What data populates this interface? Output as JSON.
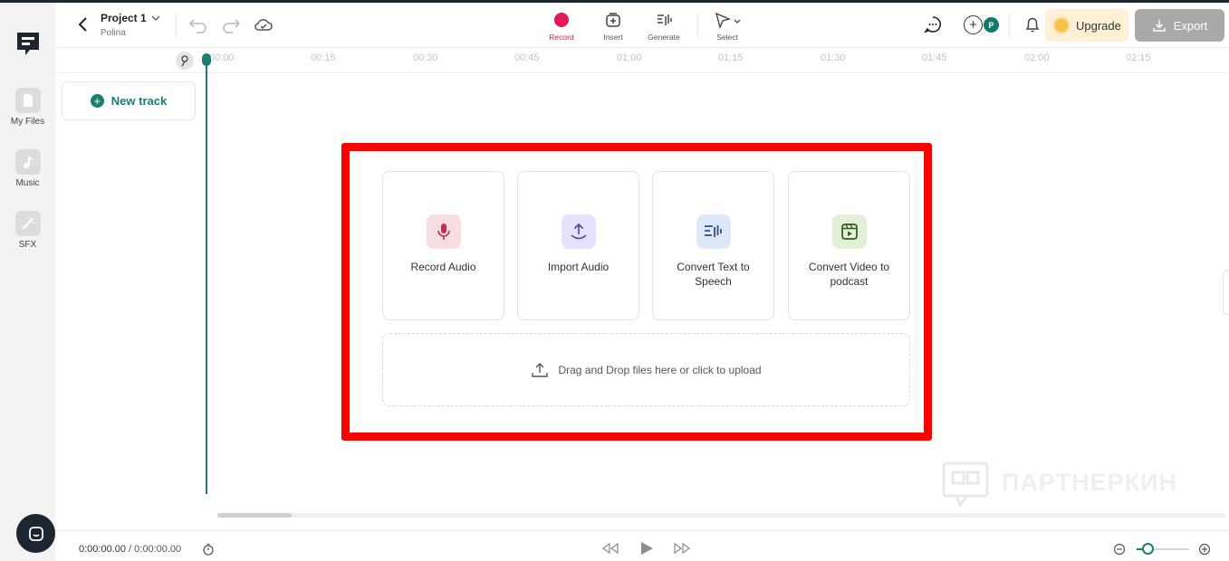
{
  "colors": {
    "accent": "#17806e",
    "record": "#e3195a",
    "highlight_frame": "#ff0000",
    "export_bg": "#a9a9a9",
    "upgrade_bg": "#fdf0d5"
  },
  "sidebar": {
    "items": [
      {
        "label": "My Files",
        "icon": "folder-icon"
      },
      {
        "label": "Music",
        "icon": "music-note-icon"
      },
      {
        "label": "SFX",
        "icon": "magic-wand-icon"
      }
    ]
  },
  "header": {
    "project_title": "Project 1",
    "project_owner": "Polina",
    "tools": [
      {
        "label": "Record",
        "icon": "record-icon"
      },
      {
        "label": "Insert",
        "icon": "insert-icon"
      },
      {
        "label": "Generate",
        "icon": "generate-icon"
      },
      {
        "label": "Select",
        "icon": "cursor-icon"
      }
    ],
    "avatar_initial": "P",
    "upgrade_label": "Upgrade",
    "export_label": "Export"
  },
  "ruler": {
    "ticks": [
      "00:00",
      "00:15",
      "00:30",
      "00:45",
      "01:00",
      "01:15",
      "01:30",
      "01:45",
      "02:00",
      "02:15"
    ]
  },
  "tracks": {
    "new_track_label": "New track"
  },
  "start_options": {
    "cards": [
      {
        "label": "Record Audio",
        "icon": "microphone-icon"
      },
      {
        "label": "Import Audio",
        "icon": "upload-icon"
      },
      {
        "label": "Convert Text to Speech",
        "icon": "text-to-speech-icon"
      },
      {
        "label": "Convert Video to podcast",
        "icon": "video-icon"
      }
    ],
    "dropzone_label": "Drag and Drop files here or click to upload"
  },
  "footer": {
    "current_time": "0:00:00.00",
    "separator": " / ",
    "total_time": "0:00:00.00"
  },
  "watermark": {
    "text": "ПАРТНЕРКИН"
  }
}
